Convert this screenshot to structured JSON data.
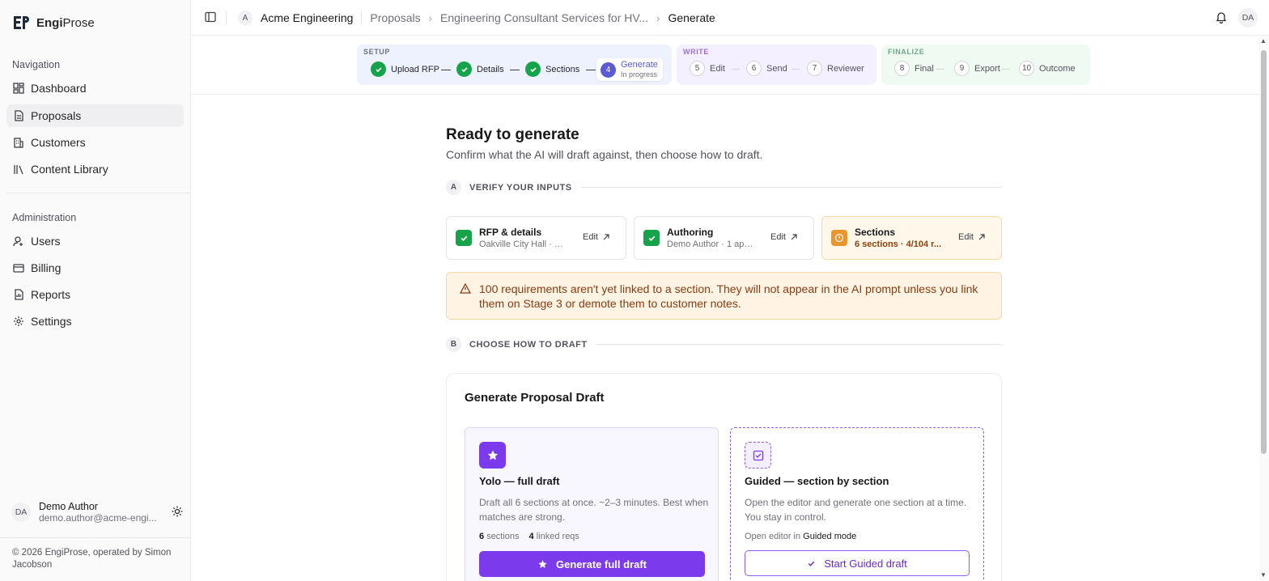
{
  "brand": {
    "name_a": "Engi",
    "name_b": "Prose"
  },
  "sidebar": {
    "nav_label": "Navigation",
    "nav_items": [
      {
        "label": "Dashboard",
        "icon": "dashboard-icon"
      },
      {
        "label": "Proposals",
        "icon": "document-icon",
        "active": true
      },
      {
        "label": "Customers",
        "icon": "building-icon"
      },
      {
        "label": "Content Library",
        "icon": "library-icon"
      }
    ],
    "admin_label": "Administration",
    "admin_items": [
      {
        "label": "Users",
        "icon": "user-icon"
      },
      {
        "label": "Billing",
        "icon": "credit-card-icon"
      },
      {
        "label": "Reports",
        "icon": "report-icon"
      },
      {
        "label": "Settings",
        "icon": "gear-icon"
      }
    ],
    "user": {
      "initials": "DA",
      "name": "Demo Author",
      "email": "demo.author@acme-engi..."
    },
    "footer": "© 2026 EngiProse, operated by Simon Jacobson"
  },
  "topbar": {
    "org_initial": "A",
    "org_name": "Acme Engineering",
    "crumb_proposals": "Proposals",
    "crumb_proposal": "Engineering Consultant Services for HV...",
    "crumb_current": "Generate",
    "user_initials": "DA"
  },
  "stepper": {
    "setup": {
      "label": "SETUP",
      "steps": [
        "Upload RFP",
        "Details",
        "Sections"
      ],
      "current": {
        "num": "4",
        "label": "Generate",
        "status": "In progress"
      }
    },
    "write": {
      "label": "WRITE",
      "steps": [
        {
          "num": "5",
          "label": "Edit"
        },
        {
          "num": "6",
          "label": "Send"
        },
        {
          "num": "7",
          "label": "Reviewer"
        }
      ]
    },
    "finalize": {
      "label": "FINALIZE",
      "steps": [
        {
          "num": "8",
          "label": "Final"
        },
        {
          "num": "9",
          "label": "Export"
        },
        {
          "num": "10",
          "label": "Outcome"
        }
      ]
    },
    "colors": {
      "done": "#16a34a",
      "current": "#5b5bd6",
      "setup_bg": "#eef2ff",
      "write_bg": "#f5f0ff",
      "finalize_bg": "#effaf2"
    }
  },
  "main": {
    "title": "Ready to generate",
    "subtitle": "Confirm what the AI will draft against, then choose how to draft.",
    "section_a": {
      "badge": "A",
      "label": "VERIFY YOUR INPUTS"
    },
    "inputs": [
      {
        "title": "RFP & details",
        "sub": "Oakville City Hall · D...",
        "edit": "Edit",
        "state": "done"
      },
      {
        "title": "Authoring",
        "sub": "Demo Author · 1 app...",
        "edit": "Edit",
        "state": "done"
      },
      {
        "title": "Sections",
        "sub": "6 sections · 4/104 r...",
        "edit": "Edit",
        "state": "warning"
      }
    ],
    "alert": "100 requirements aren't yet linked to a section. They will not appear in the AI prompt unless you link them on Stage 3 or demote them to customer notes.",
    "section_b": {
      "badge": "B",
      "label": "CHOOSE HOW TO DRAFT"
    },
    "generate": {
      "title": "Generate Proposal Draft",
      "yolo": {
        "title": "Yolo — full draft",
        "desc": "Draft all 6 sections at once. ~2–3 minutes. Best when matches are strong.",
        "sections_count": "6",
        "sections_label": "sections",
        "reqs_count": "4",
        "reqs_label": "linked reqs",
        "button": "Generate full draft"
      },
      "guided": {
        "title": "Guided — section by section",
        "desc": "Open the editor and generate one section at a time. You stay in control.",
        "meta_prefix": "Open editor in",
        "meta_mode": "Guided mode",
        "button": "Start Guided draft"
      }
    }
  }
}
